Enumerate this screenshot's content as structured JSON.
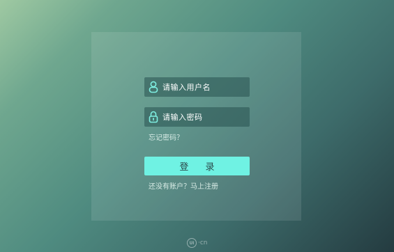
{
  "login": {
    "username_placeholder": "请输入用户名",
    "password_placeholder": "请输入密码",
    "forgot_password": "忘记密码？",
    "login_button": "登 录",
    "signup_prompt": "还没有账户？马上注册"
  },
  "brand": {
    "mark": "UI",
    "suffix": "·cn"
  },
  "colors": {
    "accent": "#6ff2e3",
    "icon": "#7ff0e2"
  },
  "icons": {
    "username": "user-icon",
    "password": "lock-icon"
  }
}
